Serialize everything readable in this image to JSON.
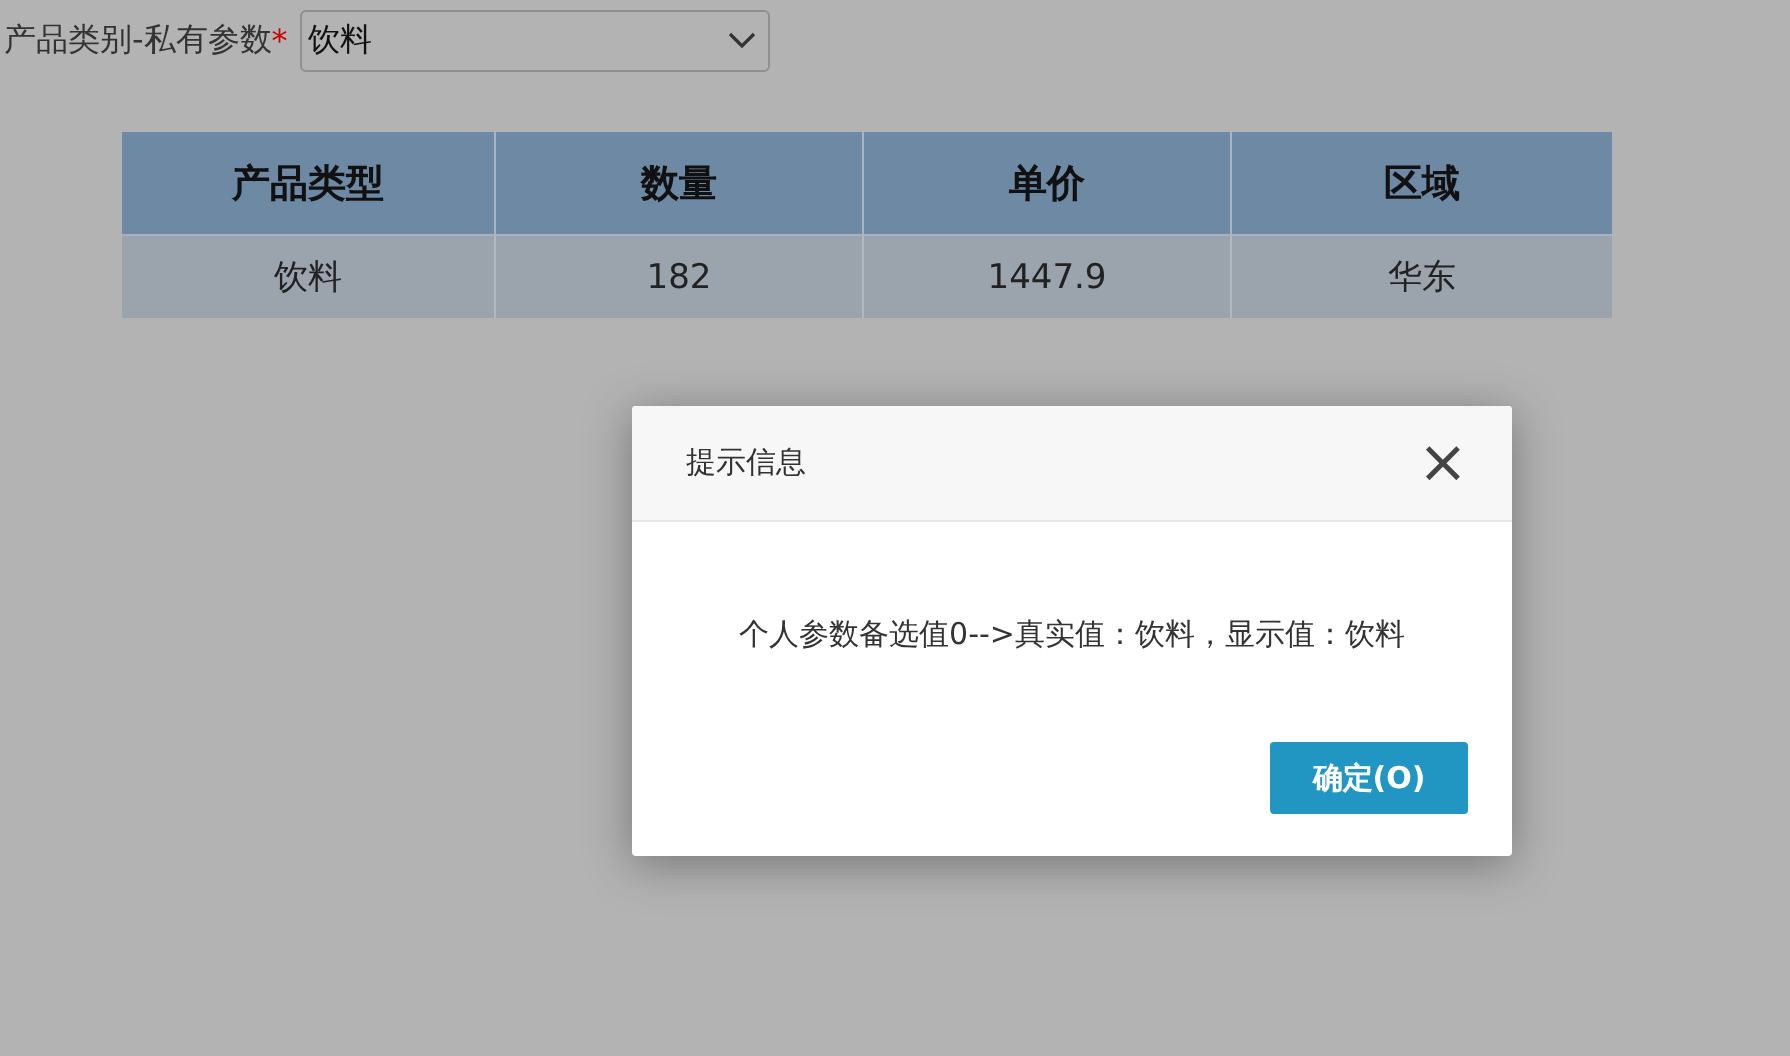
{
  "filter": {
    "label": "产品类别-私有参数",
    "required_mark": "*",
    "value": "饮料"
  },
  "table": {
    "columns": [
      "产品类型",
      "数量",
      "单价",
      "区域"
    ],
    "rows": [
      [
        "饮料",
        "182",
        "1447.9",
        "华东"
      ]
    ]
  },
  "dialog": {
    "title": "提示信息",
    "close": "×",
    "message": "个人参数备选值0-->真实值：饮料，显示值：饮料",
    "button": "确定(O)"
  }
}
